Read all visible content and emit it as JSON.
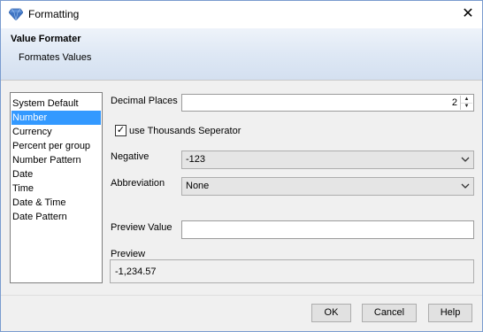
{
  "window": {
    "title": "Formatting",
    "close_glyph": "✕",
    "icon": "diamond-icon"
  },
  "banner": {
    "title": "Value Formater",
    "subtitle": "Formates Values"
  },
  "format_list": {
    "items": [
      {
        "label": "System Default"
      },
      {
        "label": "Number"
      },
      {
        "label": "Currency"
      },
      {
        "label": "Percent per group"
      },
      {
        "label": "Number Pattern"
      },
      {
        "label": "Date"
      },
      {
        "label": "Time"
      },
      {
        "label": "Date & Time"
      },
      {
        "label": "Date Pattern"
      }
    ],
    "selected": "Number"
  },
  "decimal_places": {
    "label": "Decimal Places",
    "value": "2"
  },
  "thousands_separator": {
    "label": "use Thousands Seperator",
    "checked": true,
    "check_glyph": "✓"
  },
  "negative": {
    "label": "Negative",
    "value": "-123"
  },
  "abbreviation": {
    "label": "Abbreviation",
    "value": "None"
  },
  "preview_value": {
    "label": "Preview Value",
    "value": ""
  },
  "preview": {
    "label": "Preview",
    "value": "-1,234.57"
  },
  "buttons": {
    "ok": "OK",
    "cancel": "Cancel",
    "help": "Help"
  },
  "colors": {
    "selection": "#3399ff",
    "banner_gradient_top": "#eef3fa",
    "banner_gradient_bottom": "#d4e0f0"
  }
}
